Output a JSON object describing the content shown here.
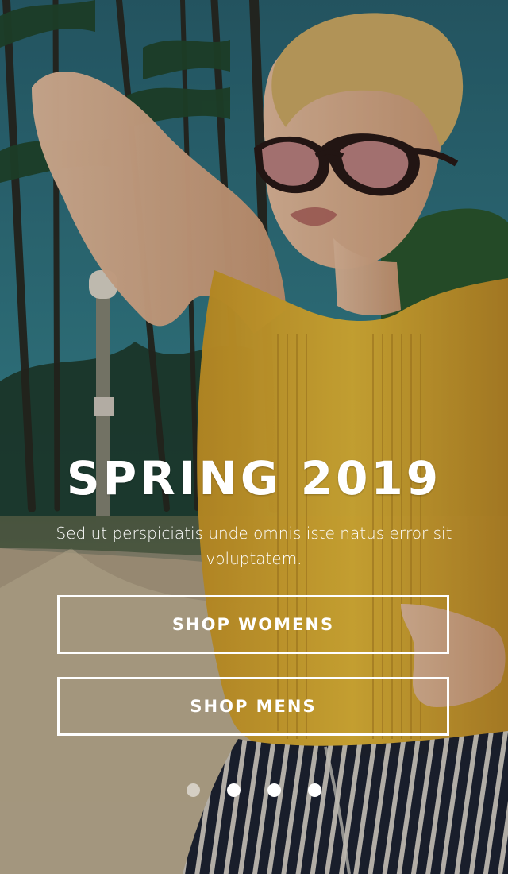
{
  "hero": {
    "title": "SPRING 2019",
    "subtitle": "Sed ut perspiciatis unde omnis iste natus error sit voluptatem.",
    "buttons": [
      {
        "label": "SHOP WOMENS"
      },
      {
        "label": "SHOP MENS"
      }
    ],
    "carousel": {
      "slides": 4,
      "active_index": 0
    }
  },
  "colors": {
    "sky": "#2f6c79",
    "shirt": "#e1ad2a",
    "pants": "#1c2233",
    "text": "#ffffff"
  }
}
